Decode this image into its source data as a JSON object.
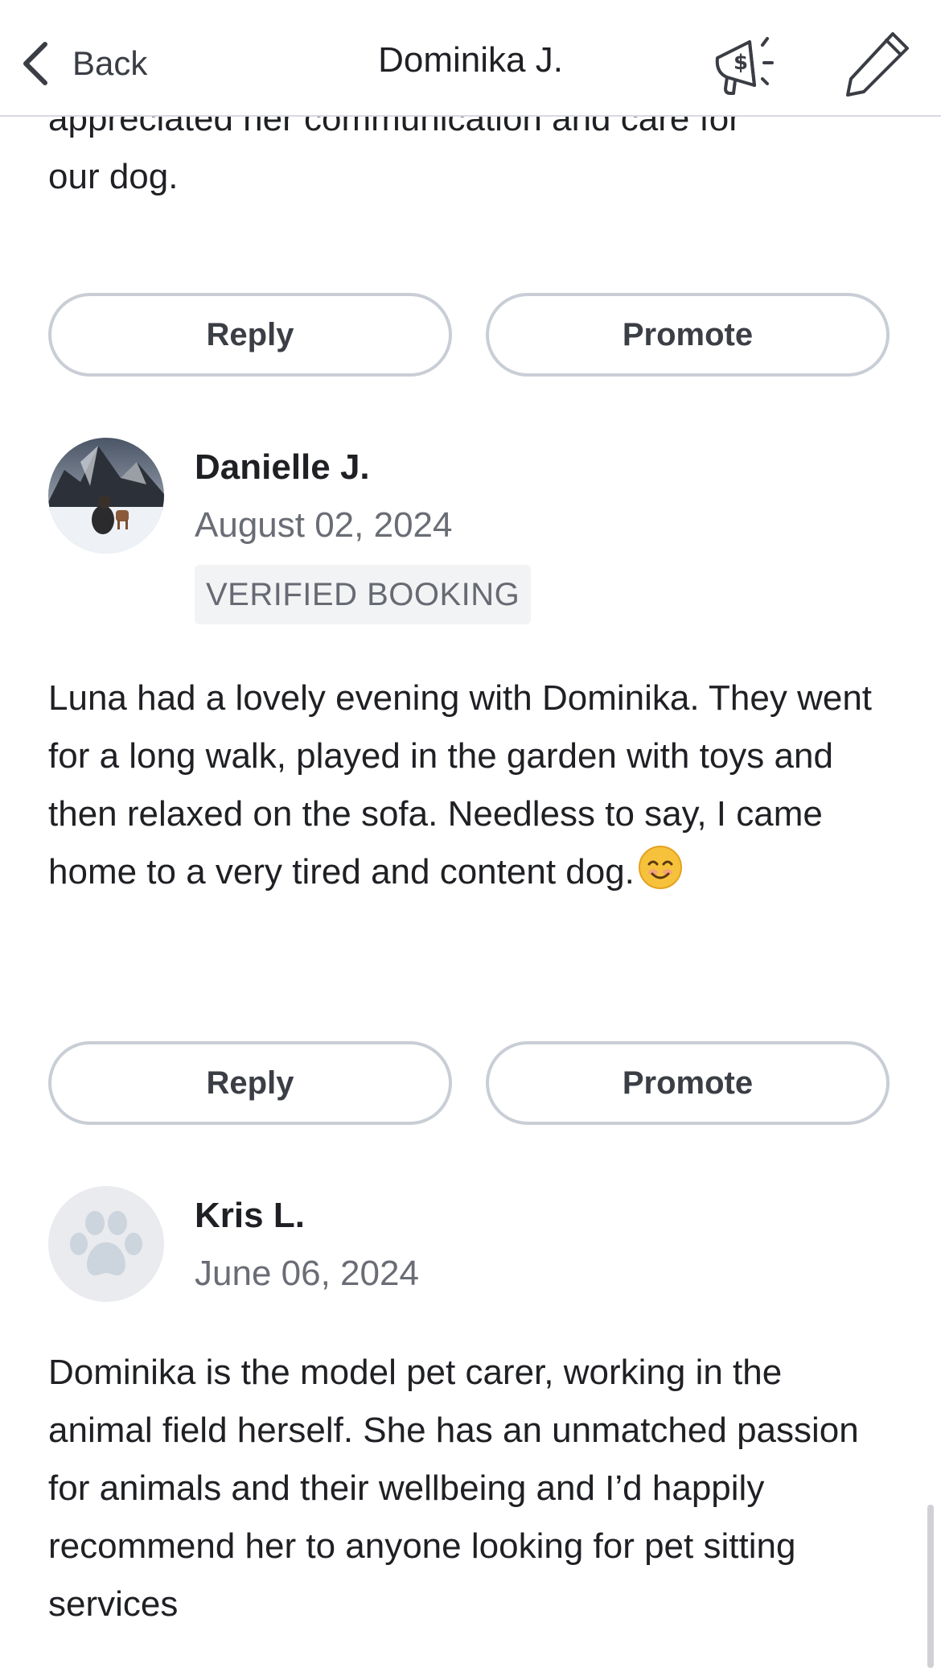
{
  "header": {
    "back_label": "Back",
    "title": "Dominika J.",
    "promote_icon": "megaphone-dollar-icon",
    "edit_icon": "pencil-icon"
  },
  "reviews": [
    {
      "text_fragment_top": "appreciated her communication and care for",
      "text_fragment_end": "our dog.",
      "reply_label": "Reply",
      "promote_label": "Promote"
    },
    {
      "name": "Danielle J.",
      "date": "August 02, 2024",
      "badge": "VERIFIED BOOKING",
      "text": "Luna had a lovely evening with Dominika. They went for a long walk, played in the garden with toys and then relaxed on the sofa. Needless to say, I came home to a very tired and content dog.",
      "emoji": "smiling-face-emoji",
      "reply_label": "Reply",
      "promote_label": "Promote"
    },
    {
      "name": "Kris L.",
      "date": "June 06, 2024",
      "avatar_icon": "paw-icon",
      "text": "Dominika is the model pet carer, working in the animal field herself. She has an unmatched passion for animals and their wellbeing and I’d happily recommend her to anyone looking for pet sitting services"
    }
  ],
  "colors": {
    "text_primary": "#1f2024",
    "text_secondary": "#6a6d75",
    "pill_border": "#c9ced6",
    "badge_bg": "#f2f3f5",
    "divider": "#d8dadf"
  }
}
